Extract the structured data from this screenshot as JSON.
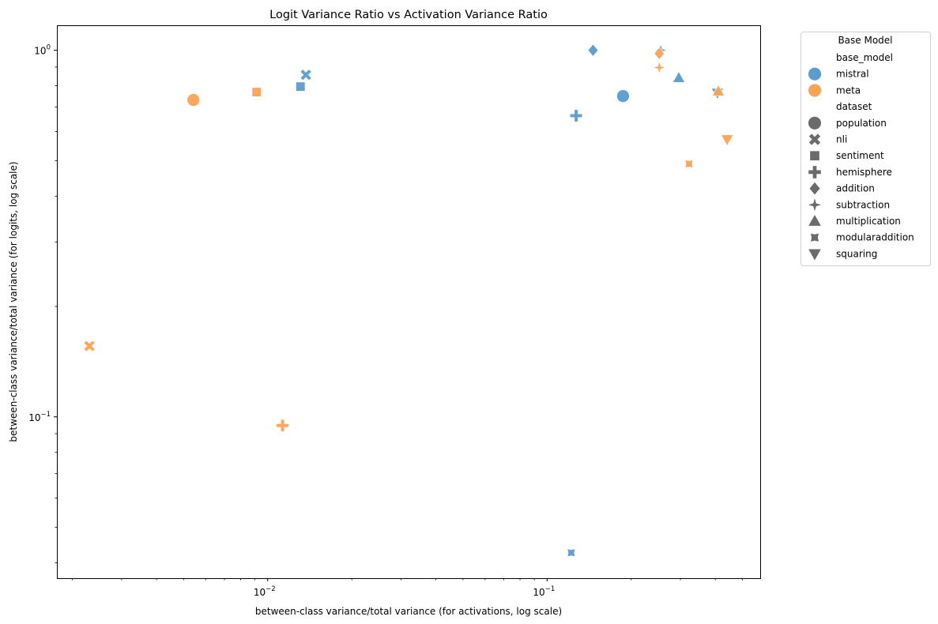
{
  "chart_data": {
    "type": "scatter",
    "title": "Logit Variance Ratio vs Activation Variance Ratio",
    "xlabel": "between-class variance/total variance (for activations, log scale)",
    "ylabel": "between-class variance/total variance (for logits, log scale)",
    "xscale": "log",
    "yscale": "log",
    "xlim": [
      0.00176,
      0.579
    ],
    "ylim": [
      0.0363,
      1.17
    ],
    "x_major_ticks": [
      {
        "value": 0.01,
        "base": "10",
        "exp": "−2"
      },
      {
        "value": 0.1,
        "base": "10",
        "exp": "−1"
      }
    ],
    "y_major_ticks": [
      {
        "value": 0.1,
        "base": "10",
        "exp": "−1"
      },
      {
        "value": 1.0,
        "base": "10",
        "exp": "0"
      }
    ],
    "grid": false,
    "legend": {
      "title": "Base Model",
      "placement": "outside-top-right",
      "hue_header": "base_model",
      "hue_entries": [
        {
          "label": "mistral",
          "color": "#5b9bd0"
        },
        {
          "label": "meta",
          "color": "#fda354"
        }
      ],
      "style_header": "dataset",
      "style_entries": [
        {
          "label": "population",
          "marker": "circle"
        },
        {
          "label": "nli",
          "marker": "x"
        },
        {
          "label": "sentiment",
          "marker": "square"
        },
        {
          "label": "hemisphere",
          "marker": "plus"
        },
        {
          "label": "addition",
          "marker": "diamond"
        },
        {
          "label": "subtraction",
          "marker": "star4"
        },
        {
          "label": "multiplication",
          "marker": "triangle-up"
        },
        {
          "label": "modularaddition",
          "marker": "star4-thick"
        },
        {
          "label": "squaring",
          "marker": "triangle-down"
        }
      ],
      "style_color": "#6b6b6b"
    },
    "series": [
      {
        "name": "mistral",
        "color": "#5b9bd0",
        "points": [
          {
            "dataset": "population",
            "x": 0.187,
            "y": 0.75
          },
          {
            "dataset": "nli",
            "x": 0.0137,
            "y": 0.857
          },
          {
            "dataset": "sentiment",
            "x": 0.0131,
            "y": 0.796
          },
          {
            "dataset": "hemisphere",
            "x": 0.127,
            "y": 0.663
          },
          {
            "dataset": "addition",
            "x": 0.146,
            "y": 1.0
          },
          {
            "dataset": "subtraction",
            "x": 0.255,
            "y": 1.0
          },
          {
            "dataset": "multiplication",
            "x": 0.296,
            "y": 0.841
          },
          {
            "dataset": "modularaddition",
            "x": 0.122,
            "y": 0.0426
          },
          {
            "dataset": "squaring",
            "x": 0.407,
            "y": 0.765
          }
        ]
      },
      {
        "name": "meta",
        "color": "#fda354",
        "points": [
          {
            "dataset": "population",
            "x": 0.00542,
            "y": 0.732
          },
          {
            "dataset": "nli",
            "x": 0.0023,
            "y": 0.156
          },
          {
            "dataset": "sentiment",
            "x": 0.00913,
            "y": 0.769
          },
          {
            "dataset": "hemisphere",
            "x": 0.0113,
            "y": 0.0947
          },
          {
            "dataset": "addition",
            "x": 0.252,
            "y": 0.98
          },
          {
            "dataset": "subtraction",
            "x": 0.252,
            "y": 0.897
          },
          {
            "dataset": "multiplication",
            "x": 0.41,
            "y": 0.773
          },
          {
            "dataset": "modularaddition",
            "x": 0.322,
            "y": 0.49
          },
          {
            "dataset": "squaring",
            "x": 0.441,
            "y": 0.571
          }
        ]
      }
    ]
  }
}
